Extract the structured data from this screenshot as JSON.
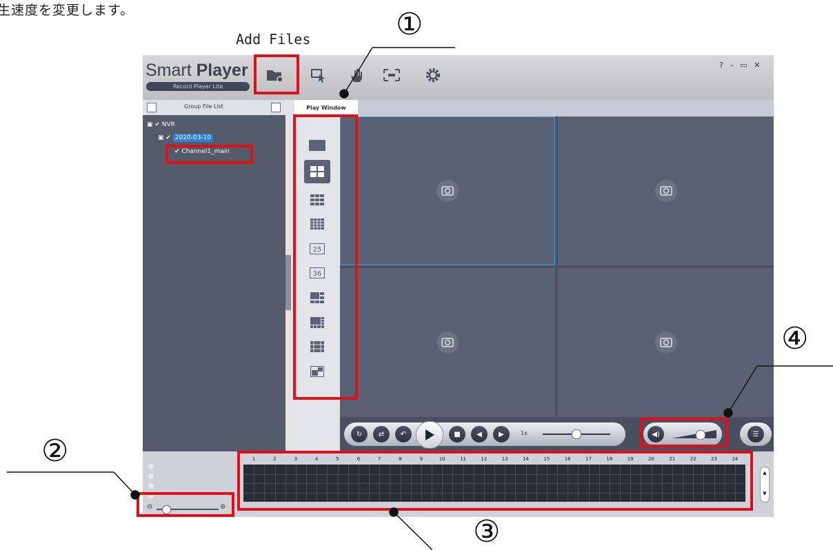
{
  "caption": "生速度を変更します。",
  "add_files_label": "Add Files",
  "callouts": {
    "one": "①",
    "two": "②",
    "three": "③",
    "four": "④"
  },
  "app": {
    "brand_main": "Smart ",
    "brand_bold": "Player",
    "brand_sub": "Record Player Lite",
    "window_controls": "? – ▭ ✕",
    "icons": [
      "folder-add-icon",
      "select-pointer-icon",
      "hand-icon",
      "fullscreen-icon",
      "gear-icon"
    ]
  },
  "sidebar": {
    "header": "Group File List",
    "tree": {
      "root": "NVR",
      "date": "2020-03-10",
      "channel": "Channel1_main"
    }
  },
  "play_window": {
    "tab_label": "Play Window",
    "layout_icons": [
      "1x1",
      "2x2",
      "3x3",
      "4x4",
      "25",
      "36",
      "1+5",
      "1+7",
      "1+8",
      "pip"
    ],
    "selected_layout": "2x2",
    "panes": 4
  },
  "controls": {
    "speed_label": "1x"
  },
  "timeline": {
    "hours": [
      "1",
      "2",
      "3",
      "4",
      "5",
      "6",
      "7",
      "8",
      "9",
      "10",
      "11",
      "12",
      "13",
      "14",
      "15",
      "16",
      "17",
      "18",
      "19",
      "20",
      "21",
      "22",
      "23",
      "24"
    ]
  },
  "colors": {
    "highlight": "#e0101a",
    "selected_pane_border": "#4aa3e6",
    "date_highlight": "#2f7fd8"
  }
}
